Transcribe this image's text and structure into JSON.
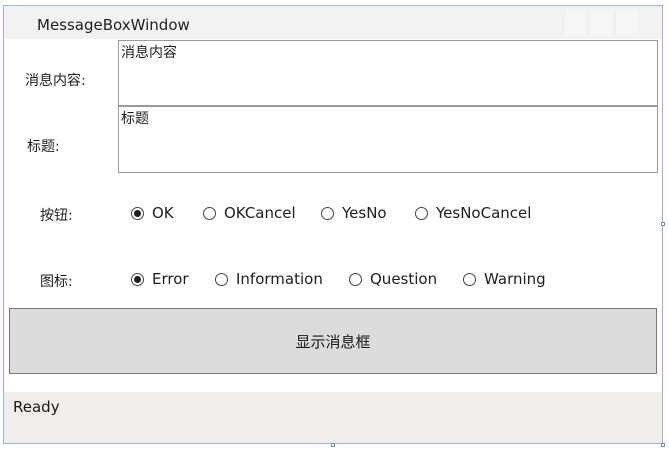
{
  "window": {
    "title": "MessageBoxWindow"
  },
  "form": {
    "content_label": "消息内容:",
    "content_value": "消息内容",
    "title_label": "标题:",
    "title_value": "标题",
    "buttons_label": "按钮:",
    "button_options": [
      {
        "label": "OK",
        "selected": true
      },
      {
        "label": "OKCancel",
        "selected": false
      },
      {
        "label": "YesNo",
        "selected": false
      },
      {
        "label": "YesNoCancel",
        "selected": false
      }
    ],
    "icon_label": "图标:",
    "icon_options": [
      {
        "label": "Error",
        "selected": true
      },
      {
        "label": "Information",
        "selected": false
      },
      {
        "label": "Question",
        "selected": false
      },
      {
        "label": "Warning",
        "selected": false
      }
    ],
    "show_button_label": "显示消息框"
  },
  "status": {
    "text": "Ready"
  }
}
